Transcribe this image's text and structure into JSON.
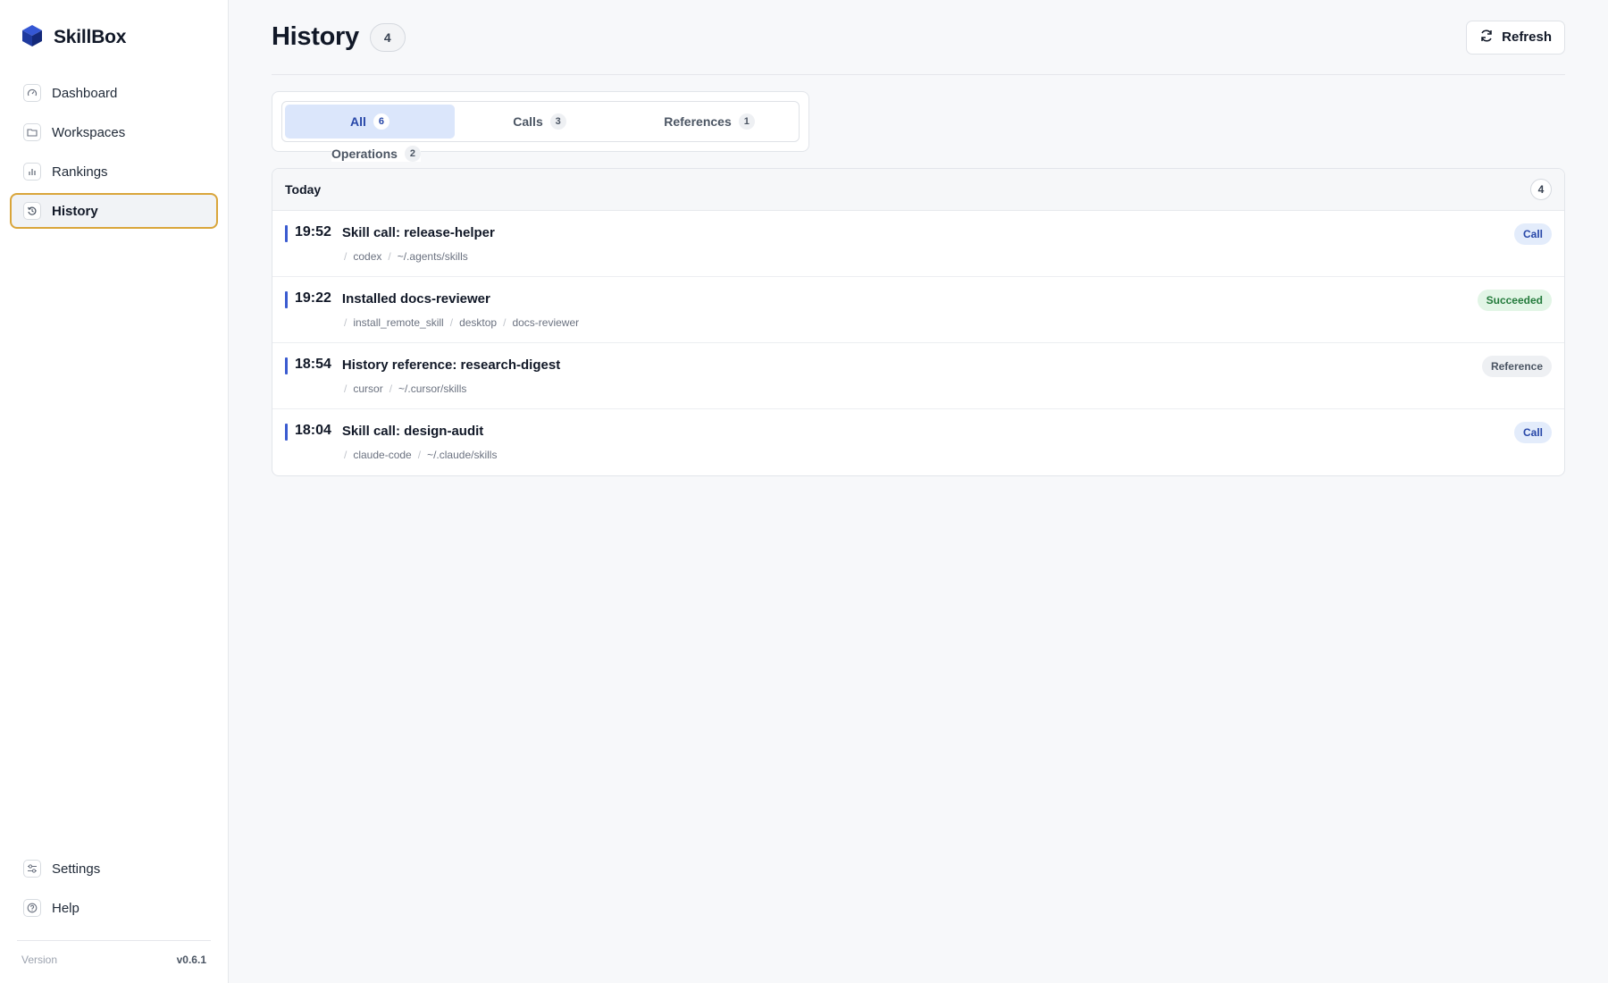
{
  "app": {
    "name": "SkillBox",
    "logo_icon": "cube-logo-icon"
  },
  "sidebar": {
    "items": [
      {
        "label": "Dashboard",
        "icon": "gauge-icon"
      },
      {
        "label": "Workspaces",
        "icon": "folder-icon"
      },
      {
        "label": "Rankings",
        "icon": "bar-chart-icon"
      },
      {
        "label": "History",
        "icon": "history-icon",
        "active": true
      }
    ],
    "bottom_items": [
      {
        "label": "Settings",
        "icon": "sliders-icon"
      },
      {
        "label": "Help",
        "icon": "help-icon"
      }
    ],
    "version_label": "Version",
    "version_value": "v0.6.1"
  },
  "header": {
    "title": "History",
    "count": "4",
    "refresh_label": "Refresh"
  },
  "tabs": [
    {
      "label": "All",
      "count": "6",
      "active": true
    },
    {
      "label": "Calls",
      "count": "3"
    },
    {
      "label": "References",
      "count": "1"
    },
    {
      "label": "Operations",
      "count": "2"
    }
  ],
  "group": {
    "title": "Today",
    "count": "4",
    "rows": [
      {
        "time": "19:52",
        "title": "Skill call: release-helper",
        "meta": [
          "codex",
          "~/.agents/skills"
        ],
        "badge": "Call",
        "badge_type": "call"
      },
      {
        "time": "19:22",
        "title": "Installed docs-reviewer",
        "meta": [
          "install_remote_skill",
          "desktop",
          "docs-reviewer"
        ],
        "badge": "Succeeded",
        "badge_type": "success"
      },
      {
        "time": "18:54",
        "title": "History reference: research-digest",
        "meta": [
          "cursor",
          "~/.cursor/skills"
        ],
        "badge": "Reference",
        "badge_type": "reference"
      },
      {
        "time": "18:04",
        "title": "Skill call: design-audit",
        "meta": [
          "claude-code",
          "~/.claude/skills"
        ],
        "badge": "Call",
        "badge_type": "call"
      }
    ]
  },
  "colors": {
    "accent": "#3a5bd0",
    "active_nav_border": "#d9a53a",
    "tab_active_bg": "#dbe6fb",
    "success": "#237a3b"
  }
}
